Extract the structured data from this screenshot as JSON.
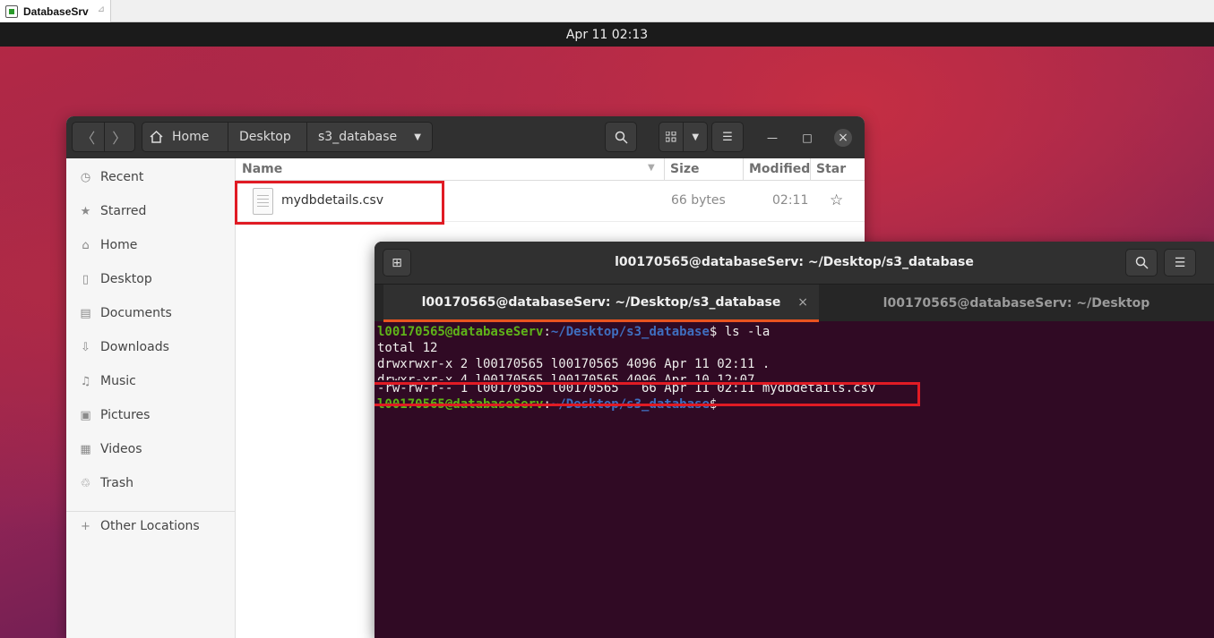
{
  "vm_tab": {
    "label": "DatabaseSrv"
  },
  "topbar": {
    "datetime": "Apr 11  02:13"
  },
  "files": {
    "breadcrumbs": [
      "Home",
      "Desktop",
      "s3_database"
    ],
    "sidebar": [
      {
        "label": "Recent",
        "icon": "clock-icon"
      },
      {
        "label": "Starred",
        "icon": "star-icon"
      },
      {
        "label": "Home",
        "icon": "home-icon"
      },
      {
        "label": "Desktop",
        "icon": "desktop-icon"
      },
      {
        "label": "Documents",
        "icon": "document-icon"
      },
      {
        "label": "Downloads",
        "icon": "download-icon"
      },
      {
        "label": "Music",
        "icon": "music-icon"
      },
      {
        "label": "Pictures",
        "icon": "picture-icon"
      },
      {
        "label": "Videos",
        "icon": "video-icon"
      },
      {
        "label": "Trash",
        "icon": "trash-icon"
      },
      {
        "label": "Other Locations",
        "icon": "plus-icon"
      }
    ],
    "columns": {
      "name": "Name",
      "size": "Size",
      "modified": "Modified",
      "star": "Star"
    },
    "rows": [
      {
        "name": "mydbdetails.csv",
        "size": "66 bytes",
        "modified": "02:11"
      }
    ]
  },
  "terminal": {
    "title": "l00170565@databaseServ: ~/Desktop/s3_database",
    "tabs": [
      {
        "label": "l00170565@databaseServ: ~/Desktop/s3_database"
      },
      {
        "label": "l00170565@databaseServ: ~/Desktop"
      }
    ],
    "prompt_user": "l00170565@databaseServ",
    "prompt_path": "~/Desktop/s3_database",
    "command": "$ ls -la",
    "output": [
      "total 12",
      "drwxrwxr-x 2 l00170565 l00170565 4096 Apr 11 02:11 .",
      "drwxr-xr-x 4 l00170565 l00170565 4096 Apr 10 12:07 ..",
      "-rw-rw-r-- 1 l00170565 l00170565   66 Apr 11 02:11 mydbdetails.csv"
    ],
    "prompt_end": "$"
  },
  "colors": {
    "accent": "#e95420",
    "highlight": "#e01b24",
    "terminal_bg": "#300a24",
    "prompt_user": "#5fb319",
    "prompt_path": "#3f6ebf"
  }
}
